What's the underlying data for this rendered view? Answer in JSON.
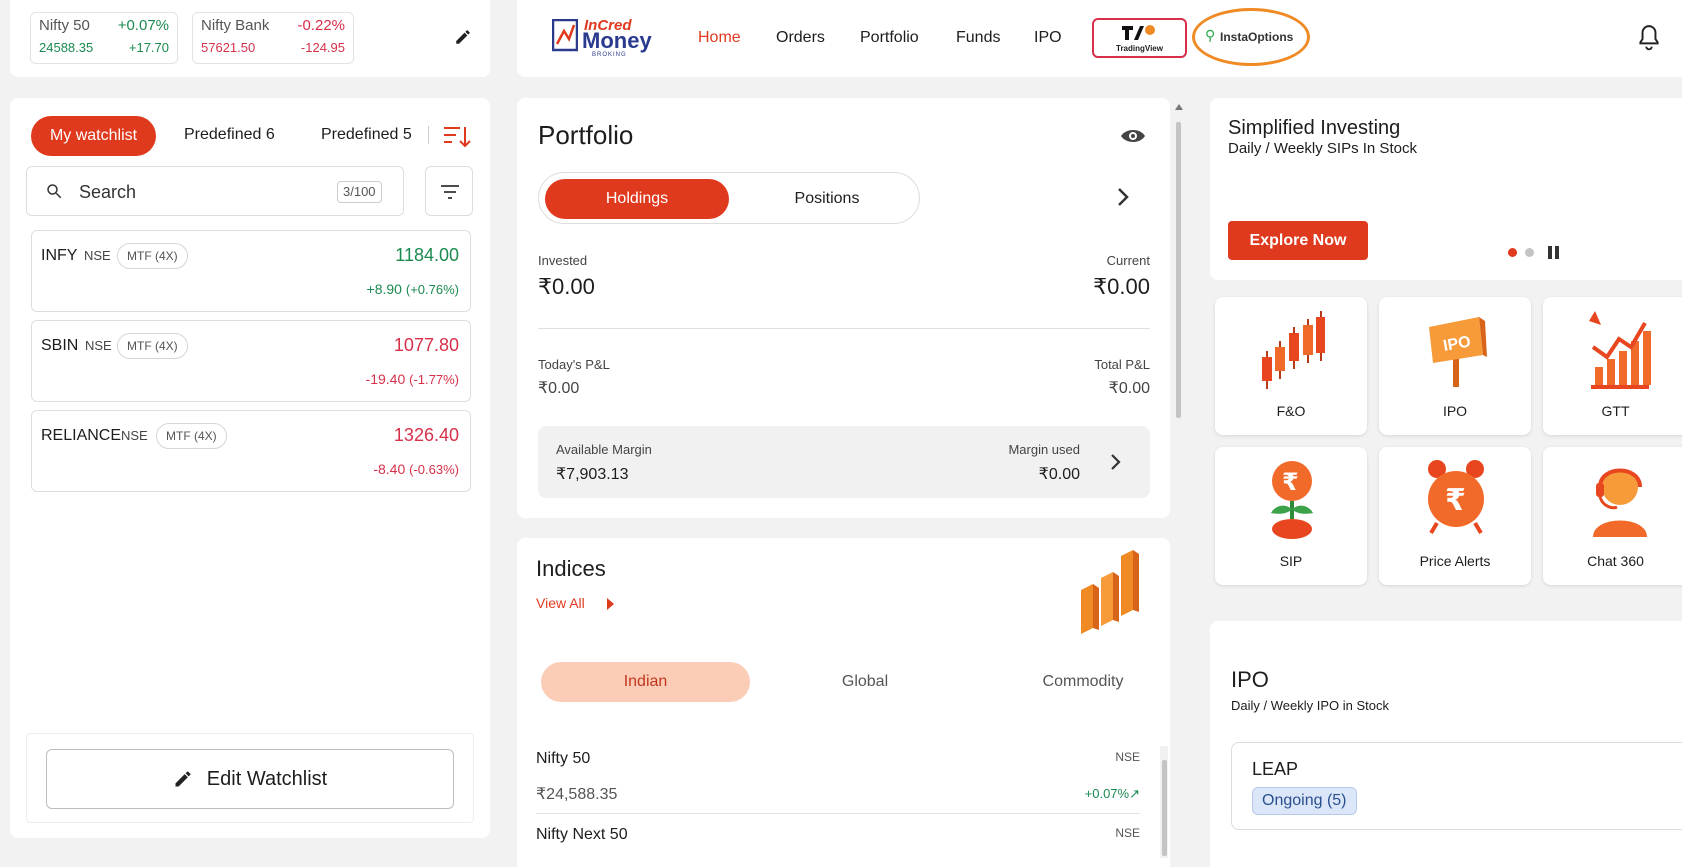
{
  "indices_bar": [
    {
      "name": "Nifty 50",
      "pct": "+0.07%",
      "value": "24588.35",
      "change": "+17.70"
    },
    {
      "name": "Nifty Bank",
      "pct": "-0.22%",
      "value": "57621.50",
      "change": "-124.95"
    }
  ],
  "brand": {
    "line1": "InCred",
    "line2": "Money",
    "line3": "BROKING"
  },
  "nav": {
    "items": [
      "Home",
      "Orders",
      "Portfolio",
      "Funds",
      "IPO"
    ],
    "tradingview": "TradingView",
    "instaoptions": "InstaOptions"
  },
  "watchlist": {
    "tabs": [
      "My watchlist",
      "Predefined 6",
      "Predefined 5"
    ],
    "search_placeholder": "Search",
    "count": "3/100",
    "stocks": [
      {
        "symbol": "INFY",
        "exchange": "NSE",
        "tag": "MTF (4X)",
        "ltp": "1184.00",
        "change": "+8.90",
        "pct": "(+0.76%)"
      },
      {
        "symbol": "SBIN",
        "exchange": "NSE",
        "tag": "MTF (4X)",
        "ltp": "1077.80",
        "change": "-19.40",
        "pct": "(-1.77%)"
      },
      {
        "symbol": "RELIANCE",
        "exchange": "NSE",
        "tag": "MTF (4X)",
        "ltp": "1326.40",
        "change": "-8.40",
        "pct": "(-0.63%)"
      }
    ],
    "edit_label": "Edit Watchlist"
  },
  "portfolio": {
    "title": "Portfolio",
    "tabs": [
      "Holdings",
      "Positions"
    ],
    "invested_label": "Invested",
    "invested": "₹0.00",
    "current_label": "Current",
    "current": "₹0.00",
    "today_pl_label": "Today's P&L",
    "today_pl": "₹0.00",
    "total_pl_label": "Total P&L",
    "total_pl": "₹0.00",
    "margin_label": "Available Margin",
    "margin": "₹7,903.13",
    "margin_used_label": "Margin used",
    "margin_used": "₹0.00"
  },
  "indices": {
    "title": "Indices",
    "view_all": "View All",
    "tabs": [
      "Indian",
      "Global",
      "Commodity"
    ],
    "rows": [
      {
        "name": "Nifty 50",
        "exchange": "NSE",
        "value": "₹24,588.35",
        "change": "+0.07%"
      },
      {
        "name": "Nifty Next 50",
        "exchange": "NSE"
      }
    ]
  },
  "promo": {
    "title": "Simplified Investing",
    "subtitle": "Daily / Weekly SIPs In Stock",
    "button": "Explore Now"
  },
  "tiles": [
    {
      "label": "F&O",
      "icon": "candlestick-chart-icon"
    },
    {
      "label": "IPO",
      "icon": "ipo-signboard-icon",
      "badge": "IPO"
    },
    {
      "label": "GTT",
      "icon": "growth-chart-icon"
    },
    {
      "label": "SIP",
      "icon": "rupee-plant-icon",
      "badge": "₹"
    },
    {
      "label": "Price Alerts",
      "icon": "alarm-clock-rupee-icon",
      "badge": "₹"
    },
    {
      "label": "Chat 360",
      "icon": "support-agent-icon"
    }
  ],
  "ipo": {
    "title": "IPO",
    "subtitle": "Daily / Weekly IPO in Stock",
    "card_title": "LEAP",
    "status": "Ongoing (5)"
  },
  "colors": {
    "accent": "#e03a1e",
    "positive": "#1a8a4f",
    "negative": "#d6304a"
  }
}
